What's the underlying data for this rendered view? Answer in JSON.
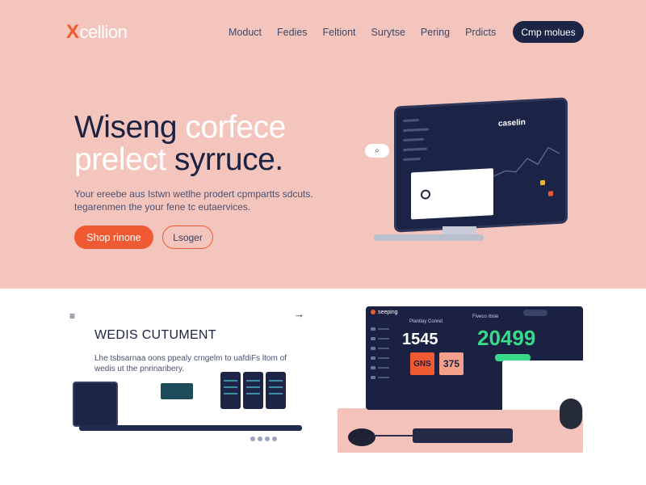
{
  "header": {
    "logo_mark": "X",
    "logo_text": "cellion",
    "nav": [
      "Moduct",
      "Fedies",
      "Feltiont",
      "Surytse",
      "Pering",
      "Prdicts"
    ],
    "cta_label": "Cmp molues"
  },
  "hero": {
    "headline_line1_a": "Wiseng",
    "headline_line1_b": "corfece",
    "headline_line2_a": "prelect",
    "headline_line2_b": "syrruce.",
    "subtext": "Your ereebe aus Istwn wetlhe prodert cpmpartts sdcuts. tegarenmen the your fene tc eutaervices.",
    "primary_button": "Shop rinone",
    "secondary_button": "Lsoger",
    "bubble_icon": "search-icon",
    "monitor_title": "caselin"
  },
  "section_left": {
    "menu_icon": "hamburger-icon",
    "arrow_icon": "arrow-right-icon",
    "title": "WEDIS CUTUMENT",
    "text": "Lhe tsbsarnaa oons ppealy crngelm to uafdiFs ltom of wedis ut the pnrinaribery."
  },
  "section_right": {
    "app_name": "seeping",
    "top_label": "Plantlay Conret",
    "right_label": "Fiveco rbsie",
    "metric_a": "1545",
    "metric_b": "20499",
    "tag_a": "GNS",
    "tag_b": "375"
  },
  "colors": {
    "hero_bg": "#f4c5bd",
    "accent": "#ef5a32",
    "navy": "#1c2545",
    "green": "#39d98a"
  }
}
